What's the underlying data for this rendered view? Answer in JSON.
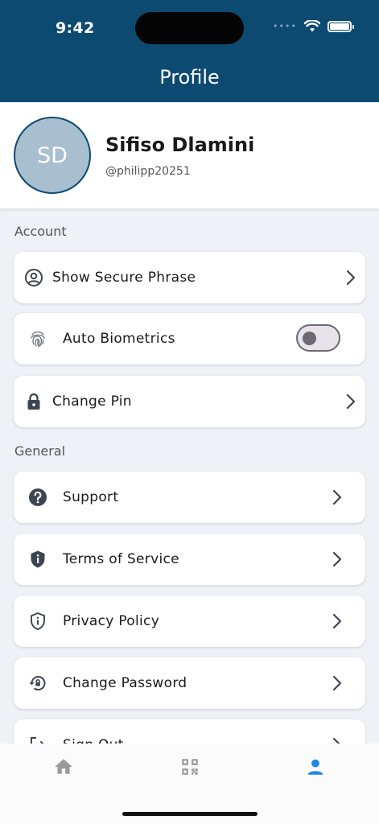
{
  "status_bar": {
    "time": "9:42",
    "signal": "••••"
  },
  "header": {
    "title": "Profile"
  },
  "profile": {
    "initials": "SD",
    "name": "Sifiso Dlamini",
    "handle": "@philipp20251"
  },
  "account": {
    "section_label": "Account",
    "items": [
      {
        "label": "Show Secure Phrase",
        "icon": "user-circle-icon"
      },
      {
        "label": "Auto Biometrics",
        "icon": "fingerprint-icon",
        "toggle_on": false
      },
      {
        "label": "Change Pin",
        "icon": "lock-icon"
      }
    ]
  },
  "general": {
    "section_label": "General",
    "items": [
      {
        "label": "Support",
        "icon": "help-icon"
      },
      {
        "label": "Terms of Service",
        "icon": "shield-info-icon"
      },
      {
        "label": "Privacy Policy",
        "icon": "shield-outline-icon"
      },
      {
        "label": "Change Password",
        "icon": "lock-reset-icon"
      },
      {
        "label": "Sign Out",
        "icon": "logout-icon"
      }
    ]
  },
  "bottom_nav": {
    "items": [
      {
        "icon": "home-icon",
        "active": false
      },
      {
        "icon": "qr-code-icon",
        "active": false
      },
      {
        "icon": "profile-icon",
        "active": true
      }
    ]
  },
  "colors": {
    "header": "#0c4a72",
    "active_tab": "#1e88e5",
    "inactive_tab": "#9a9a9a"
  }
}
